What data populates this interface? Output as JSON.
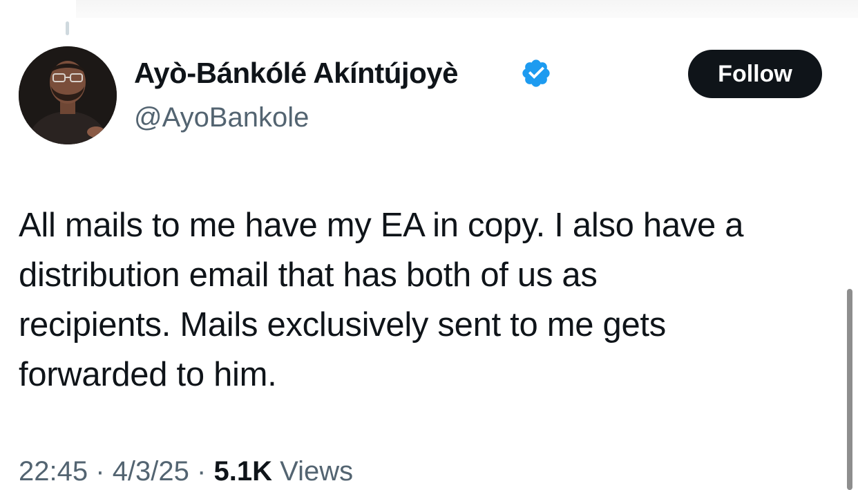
{
  "author": {
    "name": "Ayò-Bánkólé Akíntújoyè",
    "handle": "@AyoBankole",
    "verified": true,
    "verified_color": "#1d9bf0",
    "avatar_icon": "profile-photo"
  },
  "actions": {
    "follow_label": "Follow"
  },
  "tweet": {
    "lines": [
      "All mails to me have my EA in copy. I also have a",
      "distribution email that has both of us as",
      "recipients. Mails exclusively sent to me gets",
      "forwarded to him."
    ]
  },
  "meta": {
    "time": "22:45",
    "separator": "·",
    "date": "4/3/25",
    "views_count": "5.1K",
    "views_label": "Views"
  },
  "colors": {
    "text_primary": "#0f1419",
    "text_secondary": "#536471",
    "button_bg": "#0f1419",
    "button_text": "#ffffff"
  }
}
